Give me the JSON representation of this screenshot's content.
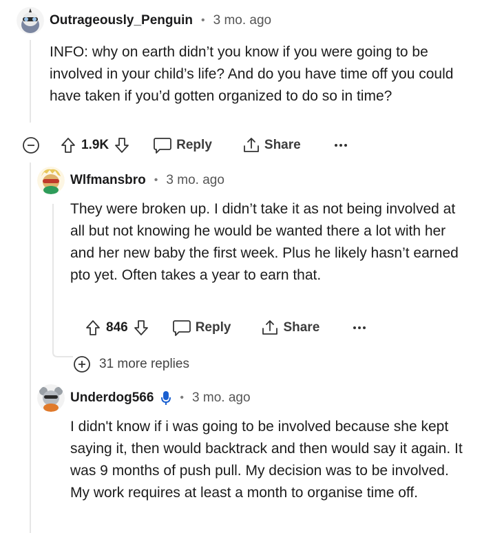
{
  "comments": [
    {
      "username": "Outrageously_Penguin",
      "separator": "•",
      "time": "3 mo. ago",
      "body": "INFO: why on earth didn’t you know if you were going to be involved in your child’s life? And do you have time off you could have taken if you’d gotten organized to do so in time?",
      "votes": "1.9K",
      "reply": "Reply",
      "share": "Share"
    },
    {
      "username": "Wlfmansbro",
      "separator": "•",
      "time": "3 mo. ago",
      "body": "They were broken up. I didn’t take it as not being involved at all but not knowing he would be wanted there a lot with her and her new baby the first week. Plus he likely hasn’t earned pto yet. Often takes a year to earn that.",
      "votes": "846",
      "reply": "Reply",
      "share": "Share"
    },
    {
      "username": "Underdog566",
      "separator": "•",
      "time": "3 mo. ago",
      "body": "I didn't know if i was going to be involved because she kept saying it, then would backtrack and then would say it again. It was 9 months of push pull. My decision was to be involved. My work requires at least a month to organise time off."
    }
  ],
  "more_replies": "31 more replies",
  "icons": {
    "upvote": "upvote-icon",
    "downvote": "downvote-icon",
    "reply": "speech-bubble-icon",
    "share": "share-icon",
    "more": "ellipsis-icon",
    "collapse": "collapse-icon",
    "expand": "expand-icon",
    "mic": "microphone-icon"
  },
  "colors": {
    "mic": "#1a5fd0",
    "thread": "#e6e6e6"
  }
}
